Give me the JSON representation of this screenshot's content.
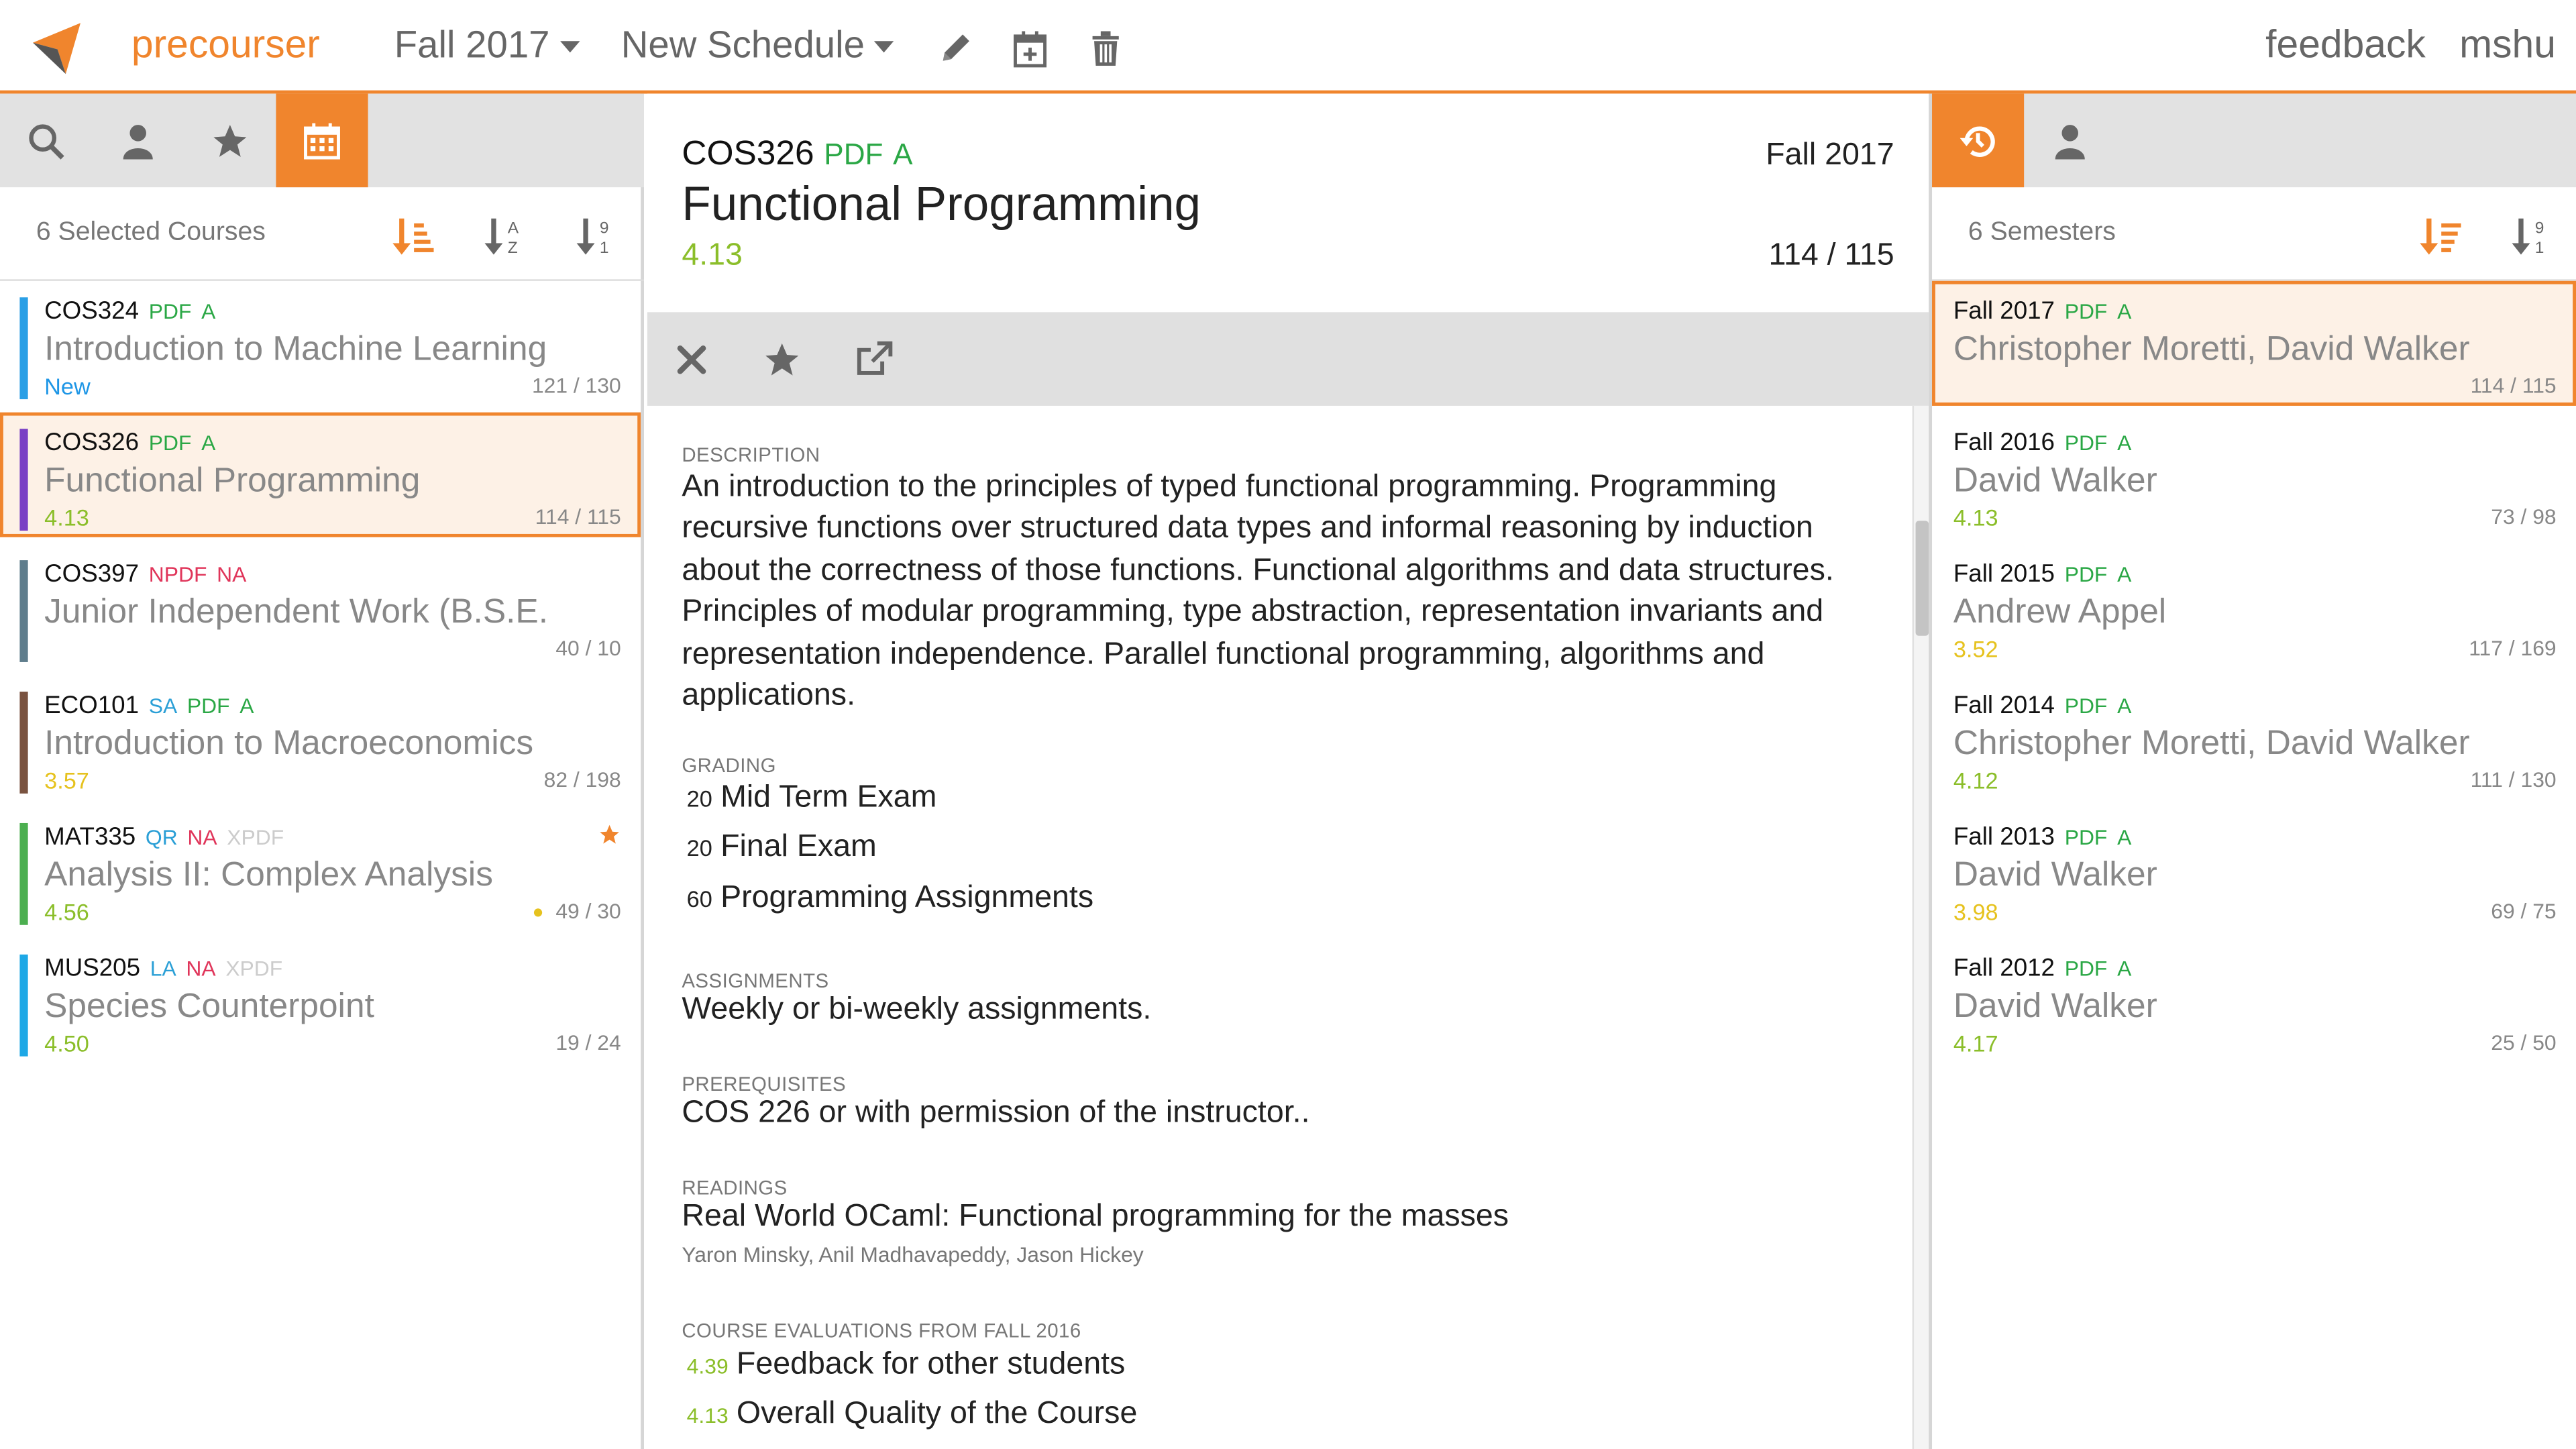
{
  "topbar": {
    "brand": "precourser",
    "semester": "Fall 2017",
    "schedule": "New Schedule",
    "feedback": "feedback",
    "user": "mshu"
  },
  "left": {
    "tabs": [
      "search-icon",
      "person-icon",
      "star-icon",
      "calendar-icon"
    ],
    "active_tab": "calendar-icon",
    "count_label": "6 Selected Courses",
    "courses": [
      {
        "code": "COS324",
        "tags": [
          {
            "t": "PDF",
            "c": "green"
          },
          {
            "t": "A",
            "c": "green"
          }
        ],
        "title": "Introduction to Machine Learning",
        "rating": "New",
        "rating_color": "#1e96e6",
        "count": "121 / 130",
        "bar": "#2a9fe6",
        "selected": false,
        "star": false,
        "dot": false
      },
      {
        "code": "COS326",
        "tags": [
          {
            "t": "PDF",
            "c": "green"
          },
          {
            "t": "A",
            "c": "green"
          }
        ],
        "title": "Functional Programming",
        "rating": "4.13",
        "rating_color": "#8bbe2a",
        "count": "114 / 115",
        "bar": "#7a3fc4",
        "selected": true,
        "star": false,
        "dot": false
      },
      {
        "code": "COS397",
        "tags": [
          {
            "t": "NPDF",
            "c": "red"
          },
          {
            "t": "NA",
            "c": "red"
          }
        ],
        "title": "Junior Independent Work (B.S.E.",
        "rating": "",
        "rating_color": "#8bbe2a",
        "count": "40 / 10",
        "bar": "#5f7d8c",
        "selected": false,
        "star": false,
        "dot": false
      },
      {
        "code": "ECO101",
        "tags": [
          {
            "t": "SA",
            "c": "blue"
          },
          {
            "t": "PDF",
            "c": "green"
          },
          {
            "t": "A",
            "c": "green"
          }
        ],
        "title": "Introduction to Macroeconomics",
        "rating": "3.57",
        "rating_color": "#e6c21e",
        "count": "82 / 198",
        "bar": "#7a5340",
        "selected": false,
        "star": false,
        "dot": false
      },
      {
        "code": "MAT335",
        "tags": [
          {
            "t": "QR",
            "c": "blue"
          },
          {
            "t": "NA",
            "c": "red"
          },
          {
            "t": "XPDF",
            "c": "light"
          }
        ],
        "title": "Analysis II: Complex Analysis",
        "rating": "4.56",
        "rating_color": "#8bbe2a",
        "count": "49 / 30",
        "bar": "#4caf50",
        "selected": false,
        "star": true,
        "dot": true
      },
      {
        "code": "MUS205",
        "tags": [
          {
            "t": "LA",
            "c": "blue"
          },
          {
            "t": "NA",
            "c": "red"
          },
          {
            "t": "XPDF",
            "c": "light"
          }
        ],
        "title": "Species Counterpoint",
        "rating": "4.50",
        "rating_color": "#8bbe2a",
        "count": "19 / 24",
        "bar": "#1ea8e6",
        "selected": false,
        "star": false,
        "dot": false
      }
    ]
  },
  "mid": {
    "code": "COS326",
    "tags": [
      "PDF",
      "A"
    ],
    "semester": "Fall 2017",
    "title": "Functional Programming",
    "rating": "4.13",
    "count": "114 / 115",
    "description_label": "DESCRIPTION",
    "description": "An introduction to the principles of typed functional programming. Programming recursive functions over structured data types and informal reasoning by induction about the correctness of those functions. Functional algorithms and data structures. Principles of modular programming, type abstraction, representation invariants and representation independence. Parallel functional programming, algorithms and applications.",
    "grading_label": "GRADING",
    "grading": [
      {
        "pct": "20",
        "item": "Mid Term Exam"
      },
      {
        "pct": "20",
        "item": "Final Exam"
      },
      {
        "pct": "60",
        "item": "Programming Assignments"
      }
    ],
    "assignments_label": "ASSIGNMENTS",
    "assignments": "Weekly or bi-weekly assignments.",
    "prereq_label": "PREREQUISITES",
    "prereq": "COS 226 or with permission of the instructor..",
    "readings_label": "READINGS",
    "reading_title": "Real World OCaml: Functional programming for the masses",
    "reading_authors": "Yaron Minsky, Anil Madhavapeddy, Jason Hickey",
    "evals_label": "COURSE EVALUATIONS FROM FALL 2016",
    "evals": [
      {
        "score": "4.39",
        "item": "Feedback for other students"
      },
      {
        "score": "4.13",
        "item": "Overall Quality of the Course"
      }
    ]
  },
  "right": {
    "count_label": "6 Semesters",
    "semesters": [
      {
        "term": "Fall 2017",
        "profs": "Christopher Moretti, David Walker",
        "rating": "",
        "rating_color": "#8bbe2a",
        "count": "114 / 115",
        "selected": true
      },
      {
        "term": "Fall 2016",
        "profs": "David Walker",
        "rating": "4.13",
        "rating_color": "#8bbe2a",
        "count": "73 / 98",
        "selected": false
      },
      {
        "term": "Fall 2015",
        "profs": "Andrew Appel",
        "rating": "3.52",
        "rating_color": "#e6c21e",
        "count": "117 / 169",
        "selected": false
      },
      {
        "term": "Fall 2014",
        "profs": "Christopher Moretti, David Walker",
        "rating": "4.12",
        "rating_color": "#8bbe2a",
        "count": "111 / 130",
        "selected": false
      },
      {
        "term": "Fall 2013",
        "profs": "David Walker",
        "rating": "3.98",
        "rating_color": "#e6c21e",
        "count": "69 / 75",
        "selected": false
      },
      {
        "term": "Fall 2012",
        "profs": "David Walker",
        "rating": "4.17",
        "rating_color": "#8bbe2a",
        "count": "25 / 50",
        "selected": false
      }
    ],
    "sem_tags": [
      "PDF",
      "A"
    ]
  },
  "colors": {
    "accent": "#f0852d",
    "green": "#2aa745",
    "red": "#e0355a",
    "blue": "#2a9fd6",
    "rating_green": "#8bbe2a",
    "rating_yellow": "#e6c21e"
  }
}
